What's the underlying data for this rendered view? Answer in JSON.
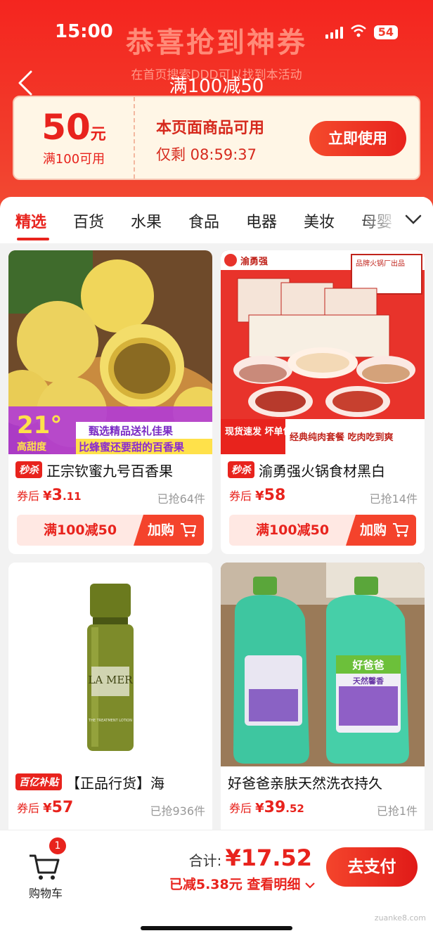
{
  "status_bar": {
    "time": "15:00",
    "battery": "54"
  },
  "banner": {
    "title": "恭喜抢到神券",
    "subtitle": "在首页搜索DDD可以找到本活动"
  },
  "nav": {
    "title": "满100减50"
  },
  "coupon": {
    "amount": "50",
    "unit": "元",
    "condition": "满100可用",
    "applicable": "本页面商品可用",
    "timer": "仅剩 08:59:37",
    "use_label": "立即使用"
  },
  "tabs": [
    {
      "label": "精选",
      "active": true
    },
    {
      "label": "百货"
    },
    {
      "label": "水果"
    },
    {
      "label": "食品"
    },
    {
      "label": "电器"
    },
    {
      "label": "美妆"
    },
    {
      "label": "母婴"
    }
  ],
  "products": [
    {
      "badge": "秒杀",
      "title": "正宗钦蜜九号百香果",
      "price_label": "券后",
      "currency": "¥",
      "price_int": "3",
      "price_dec": ".11",
      "sold": "已抢64件",
      "promo": "满100减50",
      "buy_label": "加购",
      "image": {
        "overlay_degree": "21°",
        "overlay_sub": "高甜度",
        "overlay_line1": "甄选精品送礼佳果",
        "overlay_line2": "比蜂蜜还要甜的百香果"
      }
    },
    {
      "badge": "秒杀",
      "title": "渝勇强火锅食材黑白",
      "price_label": "券后",
      "currency": "¥",
      "price_int": "58",
      "price_dec": "",
      "sold": "已抢14件",
      "promo": "满100减50",
      "buy_label": "加购",
      "image": {
        "brand": "渝勇强",
        "corner": "品牌火锅厂出品",
        "line_left": "现货速发 坏单包赔",
        "line_right": "经典纯肉套餐 吃肉吃到爽"
      }
    },
    {
      "badge": "百亿补贴",
      "title": "【正品行货】海",
      "price_label": "券后",
      "currency": "¥",
      "price_int": "57",
      "price_dec": "",
      "sold": "已抢936件",
      "image": {
        "bottle_brand": "LA MER",
        "bottle_sub": "THE TREATMENT LOTION"
      }
    },
    {
      "badge": "",
      "title": "好爸爸亲肤天然洗衣持久",
      "price_label": "券后",
      "currency": "¥",
      "price_int": "39",
      "price_dec": ".52",
      "sold": "已抢1件",
      "image": {
        "label": "好爸爸",
        "label_sub": "天然馨香"
      }
    }
  ],
  "bottom_bar": {
    "cart_label": "购物车",
    "cart_count": "1",
    "total_label": "合计:",
    "total_currency": "¥",
    "total_value": "17.52",
    "saved": "已减5.38元",
    "details": "查看明细",
    "pay_label": "去支付"
  },
  "watermark": "zuanke8.com"
}
